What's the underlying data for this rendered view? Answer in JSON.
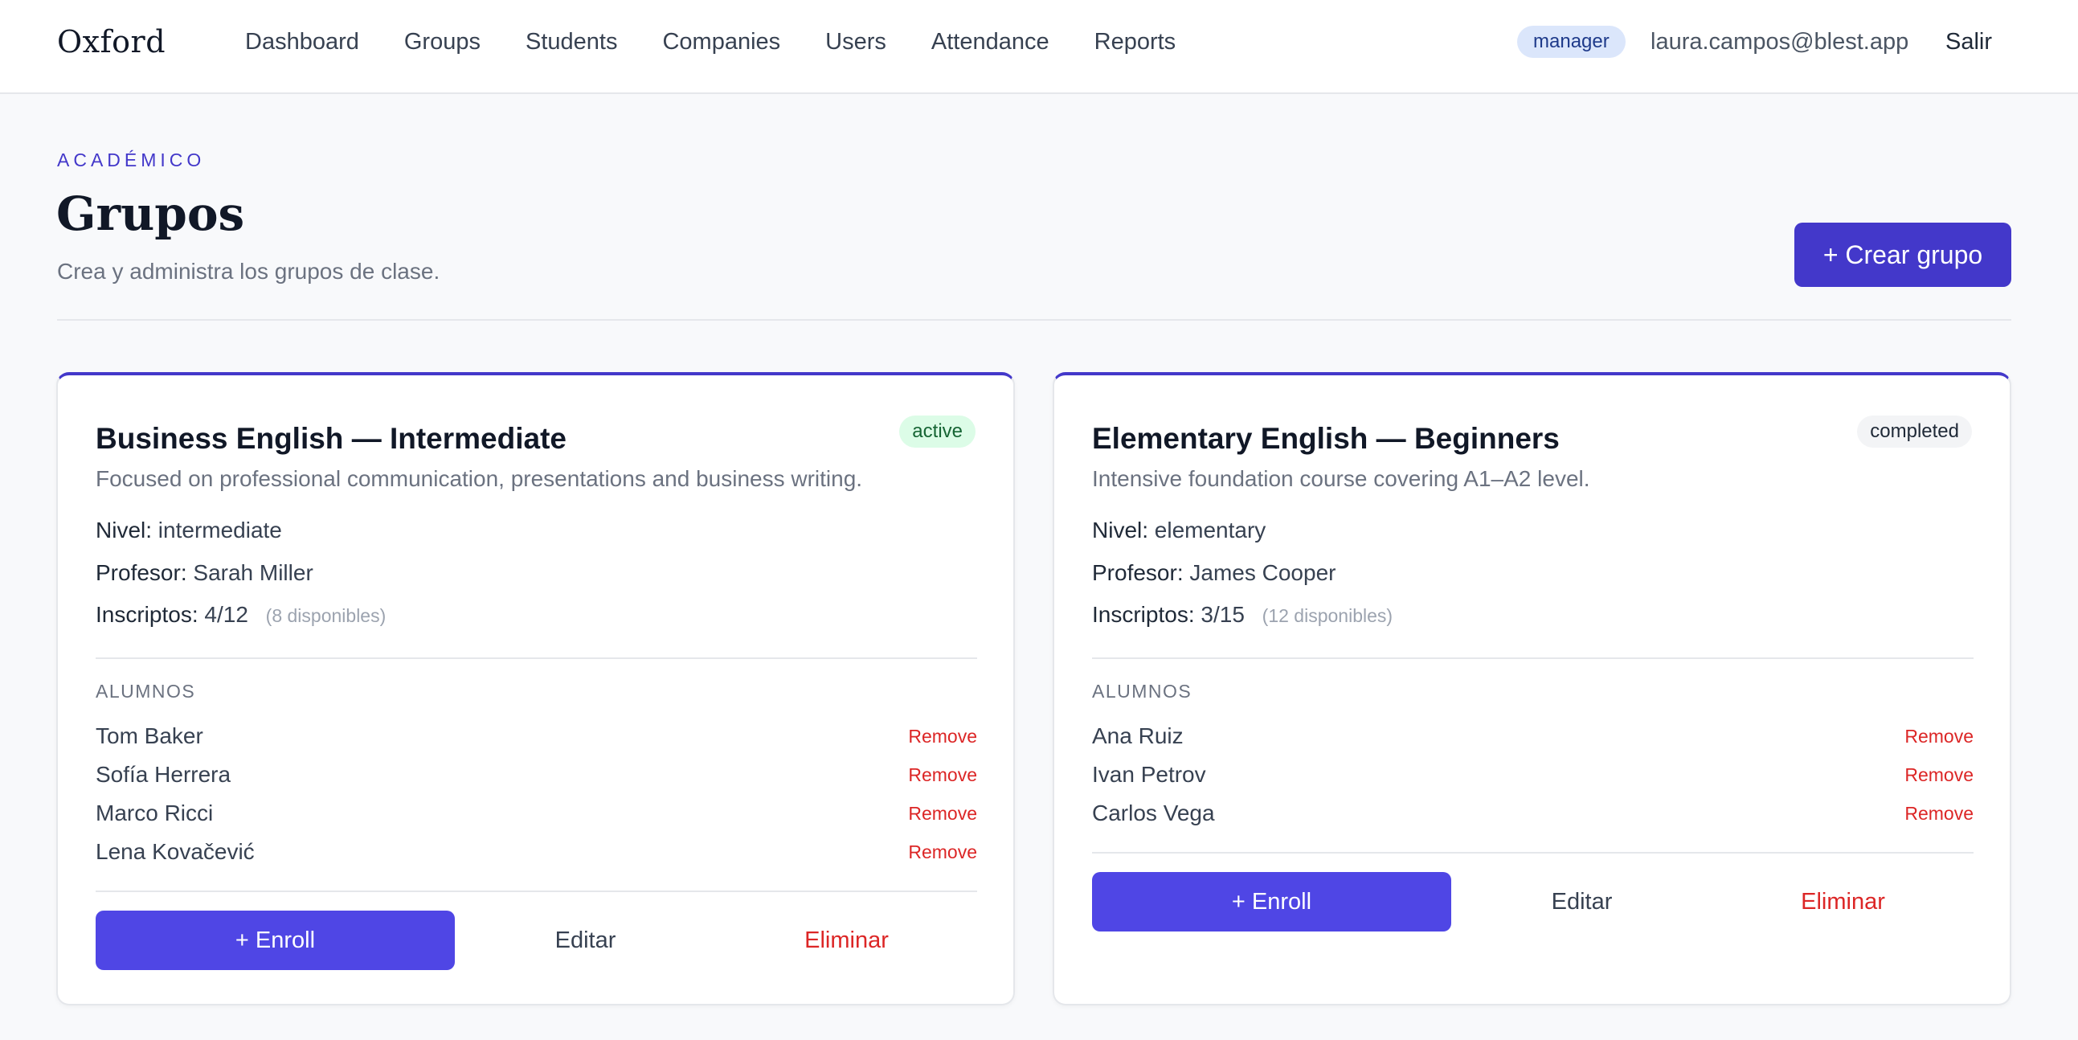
{
  "header": {
    "brand": "Oxford",
    "nav": [
      "Dashboard",
      "Groups",
      "Students",
      "Companies",
      "Users",
      "Attendance",
      "Reports"
    ],
    "role": "manager",
    "email": "laura.campos@blest.app",
    "logout": "Salir"
  },
  "page": {
    "eyebrow": "ACADÉMICO",
    "title": "Grupos",
    "subtitle": "Crea y administra los grupos de clase.",
    "create_button": "+ Crear grupo"
  },
  "labels": {
    "level": "Nivel:",
    "teacher": "Profesor:",
    "enrolled": "Inscriptos:",
    "students_section": "ALUMNOS",
    "remove": "Remove",
    "enroll": "+ Enroll",
    "edit": "Editar",
    "delete": "Eliminar"
  },
  "groups": [
    {
      "title": "Business English — Intermediate",
      "status": "active",
      "description": "Focused on professional communication, presentations and business writing.",
      "level": "intermediate",
      "teacher": "Sarah Miller",
      "enrolled": "4/12",
      "available": "(8 disponibles)",
      "students": [
        "Tom Baker",
        "Sofía Herrera",
        "Marco Ricci",
        "Lena Kovačević"
      ]
    },
    {
      "title": "Elementary English — Beginners",
      "status": "completed",
      "description": "Intensive foundation course covering A1–A2 level.",
      "level": "elementary",
      "teacher": "James Cooper",
      "enrolled": "3/15",
      "available": "(12 disponibles)",
      "students": [
        "Ana Ruiz",
        "Ivan Petrov",
        "Carlos Vega"
      ]
    }
  ]
}
